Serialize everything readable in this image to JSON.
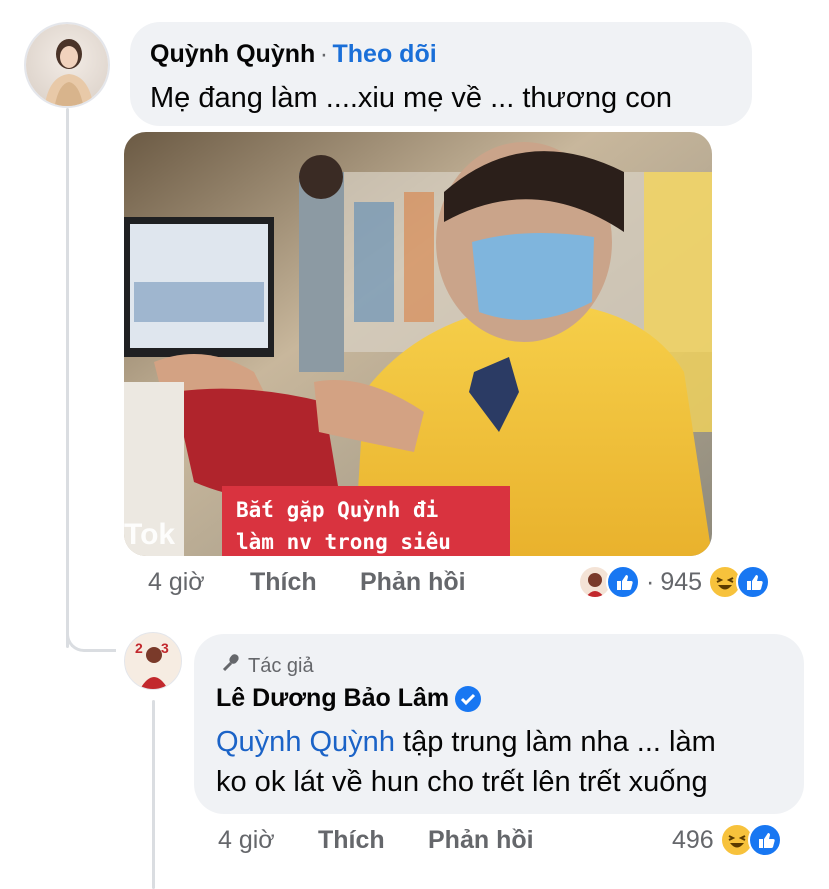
{
  "comment1": {
    "author": "Quỳnh Quỳnh",
    "separator": "·",
    "follow_label": "Theo dõi",
    "text": "Mẹ đang làm ....xiu mẹ về ... thương con",
    "media_caption_line1": "Bắt gặp Quỳnh đi",
    "media_caption_line2": "làm nv trong siêu",
    "media_watermark": "Tok",
    "time": "4 giờ",
    "like_label": "Thích",
    "reply_label": "Phản hồi",
    "reaction_dot": "·",
    "reaction_count": "945",
    "reaction_icons": [
      "avatar-sticker-icon",
      "like-icon",
      "haha-icon",
      "like-icon"
    ]
  },
  "reply1": {
    "badge_label": "Tác giả",
    "badge_icon": "microphone-icon",
    "author": "Lê Dương Bảo Lâm",
    "verified_icon": "verified-badge-icon",
    "mention": "Quỳnh Quỳnh",
    "text_line1_rest": " tập trung làm nha ... làm",
    "text_line2": "ko ok lát về hun cho trết lên trết xuống",
    "time": "4 giờ",
    "like_label": "Thích",
    "reply_label": "Phản hồi",
    "reaction_count": "496",
    "reaction_icons": [
      "haha-icon",
      "like-icon"
    ]
  },
  "colors": {
    "bubble": "#f0f2f5",
    "meta_text": "#65676b",
    "link_blue": "#1a6fd8",
    "like_blue": "#1877f2",
    "haha_yellow": "#f7c23c",
    "caption_red": "#d9333f",
    "thread_line": "#dadde1"
  }
}
